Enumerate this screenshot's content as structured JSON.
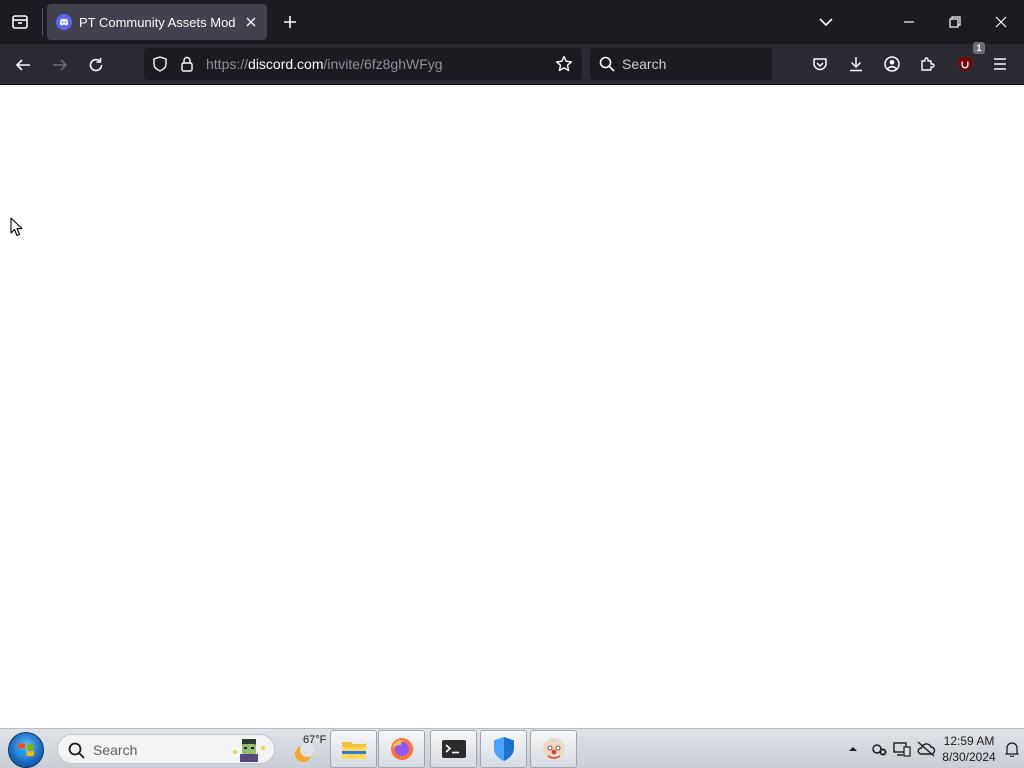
{
  "browser": {
    "tab": {
      "title": "PT Community Assets Mod"
    },
    "url": {
      "scheme": "https://",
      "host": "discord.com",
      "path": "/invite/6fz8ghWFyg"
    },
    "search_placeholder": "Search",
    "extension_badge": "1"
  },
  "taskbar": {
    "search_placeholder": "Search",
    "weather_temp": "67°F",
    "clock_time": "12:59 AM",
    "clock_date": "8/30/2024"
  },
  "colors": {
    "chrome_dark": "#1c1b22",
    "toolbar": "#2b2a33",
    "discord": "#5865f2",
    "ublock": "#800000"
  }
}
